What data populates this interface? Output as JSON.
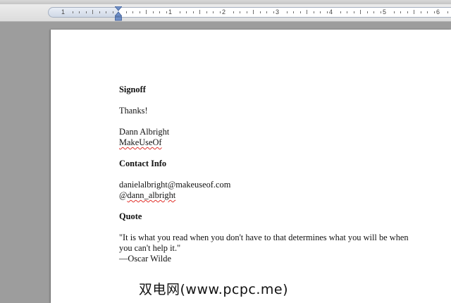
{
  "ruler": {
    "numbers": [
      "1",
      "1",
      "2",
      "3",
      "4",
      "5",
      "6"
    ]
  },
  "document": {
    "signoff_heading": "Signoff",
    "thanks": "Thanks!",
    "name": "Dann Albright",
    "company": "MakeUseOf",
    "contact_heading": "Contact Info",
    "email": "danielalbright@makeuseof.com",
    "twitter_at": "@",
    "twitter_handle": "dann_albright",
    "quote_heading": "Quote",
    "quote_line1": "\"It is what you read when you don't have to that determines what you will be when",
    "quote_line2": "you can't help it.\"",
    "quote_author": "—Oscar Wilde"
  },
  "watermark": {
    "text": "双电网(www.pcpc.me)"
  },
  "colors": {
    "spellcheck": "#e0302a",
    "ruler_track": "#cfd8e6"
  }
}
